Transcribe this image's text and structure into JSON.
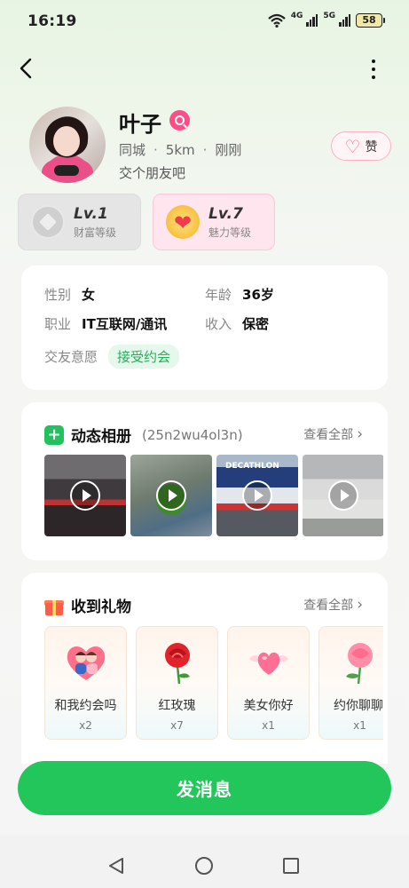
{
  "status_bar": {
    "time": "16:19",
    "net1": "4G",
    "net2": "5G",
    "battery": "58"
  },
  "profile": {
    "name": "叶子",
    "city": "同城",
    "distance": "5km",
    "active": "刚刚",
    "bio": "交个朋友吧",
    "like_label": "赞"
  },
  "levels": {
    "wealth": {
      "level": "Lv.1",
      "label": "财富等级"
    },
    "charm": {
      "level": "Lv.7",
      "label": "魅力等级"
    }
  },
  "info": {
    "gender_key": "性别",
    "gender_val": "女",
    "age_key": "年龄",
    "age_val": "36岁",
    "job_key": "职业",
    "job_val": "IT互联网/通讯",
    "income_key": "收入",
    "income_val": "保密",
    "intent_key": "交友意愿",
    "intent_val": "接受约会"
  },
  "album": {
    "title": "动态相册",
    "subtitle": "(25n2wu4ol3n)",
    "view_all": "查看全部",
    "photos": [
      {
        "name": "street-night"
      },
      {
        "name": "green-toy"
      },
      {
        "name": "decathlon-store",
        "sign": "DECATHLON"
      },
      {
        "name": "street-car"
      }
    ]
  },
  "gifts": {
    "title": "收到礼物",
    "view_all": "查看全部",
    "items": [
      {
        "name": "和我约会吗",
        "count": "x2"
      },
      {
        "name": "红玫瑰",
        "count": "x7"
      },
      {
        "name": "美女你好",
        "count": "x1"
      },
      {
        "name": "约你聊聊",
        "count": "x1"
      }
    ]
  },
  "actions": {
    "send_message": "发消息"
  },
  "colors": {
    "accent_green": "#22c65b",
    "pink": "#ff4d87"
  }
}
